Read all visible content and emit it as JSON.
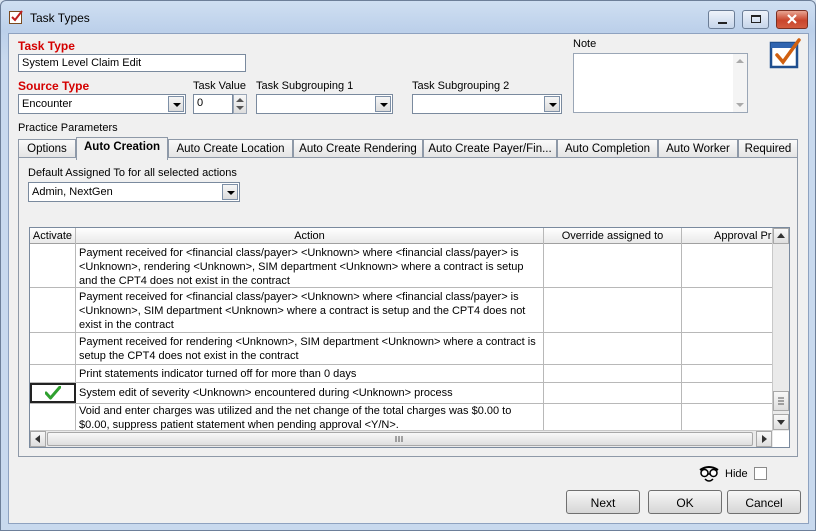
{
  "window": {
    "title": "Task Types"
  },
  "form": {
    "task_type_label": "Task Type",
    "task_type_value": "System Level Claim Edit",
    "source_type_label": "Source Type",
    "source_type_value": "Encounter",
    "task_value_label": "Task Value",
    "task_value_value": "0",
    "subgrouping1_label": "Task Subgrouping 1",
    "subgrouping1_value": "",
    "subgrouping2_label": "Task Subgrouping 2",
    "subgrouping2_value": "",
    "note_label": "Note",
    "note_value": "",
    "practice_parameters_label": "Practice Parameters"
  },
  "tabs": [
    {
      "label": "Options"
    },
    {
      "label": "Auto Creation"
    },
    {
      "label": "Auto Create Location"
    },
    {
      "label": "Auto Create Rendering"
    },
    {
      "label": "Auto Create  Payer/Fin..."
    },
    {
      "label": "Auto Completion"
    },
    {
      "label": "Auto Worker"
    },
    {
      "label": "Required"
    }
  ],
  "auto_creation": {
    "default_assigned_label": "Default Assigned To for all selected actions",
    "default_assigned_value": "Admin, NextGen"
  },
  "grid": {
    "columns": [
      "Activate",
      "Action",
      "Override assigned to",
      "Approval Pro"
    ],
    "rows": [
      {
        "activate": false,
        "action": "Payment received for <financial class/payer> <Unknown> where <financial class/payer> is <Unknown>, rendering <Unknown>, SIM department <Unknown> where a contract is setup and the CPT4 does not exist in the contract",
        "override": "",
        "approval": ""
      },
      {
        "activate": false,
        "action": "Payment received for <financial class/payer> <Unknown> where <financial class/payer> is <Unknown>, SIM department <Unknown> where a contract is setup and the CPT4 does not exist in the contract",
        "override": "",
        "approval": ""
      },
      {
        "activate": false,
        "action": "Payment received for rendering <Unknown>, SIM department <Unknown> where a contract is setup the CPT4 does not exist in the contract",
        "override": "",
        "approval": ""
      },
      {
        "activate": false,
        "action": "Print statements indicator turned off for more than 0 days",
        "override": "",
        "approval": ""
      },
      {
        "activate": true,
        "action": "System edit of severity <Unknown> encountered during <Unknown> process",
        "override": "",
        "approval": ""
      },
      {
        "activate": false,
        "action": "Void and enter charges was utilized and the net change of the total charges was $0.00 to $0.00, suppress patient statement when pending approval <Y/N>.",
        "override": "",
        "approval": ""
      }
    ]
  },
  "footer": {
    "hide_label": "Hide",
    "next_label": "Next",
    "ok_label": "OK",
    "cancel_label": "Cancel"
  },
  "colors": {
    "accent_red": "#d40000",
    "check_green": "#2fa02f"
  }
}
